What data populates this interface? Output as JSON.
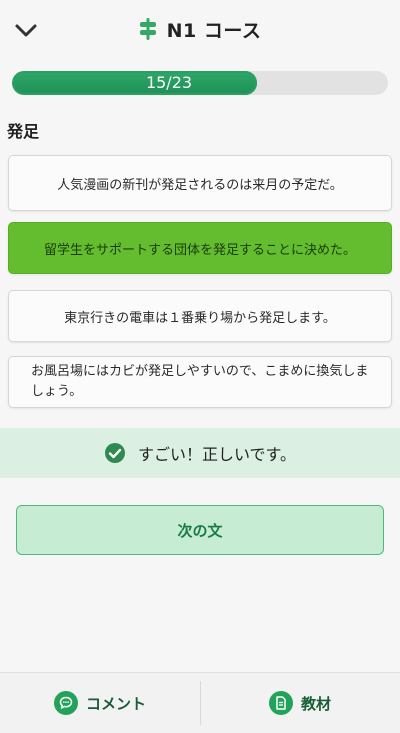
{
  "header": {
    "title": "N1 コース",
    "back_icon": "chevron-down-icon",
    "course_icon": "signpost-icon",
    "accent": "#2fa86a"
  },
  "progress": {
    "label": "15/23",
    "current": 15,
    "total": 23
  },
  "question": {
    "word": "発足"
  },
  "options": [
    {
      "text": "人気漫画の新刊が発足されるのは来月の予定だ。",
      "selected": false
    },
    {
      "text": "留学生をサポートする団体を発足することに決めた。",
      "selected": true
    },
    {
      "text": "東京行きの電車は１番乗り場から発足します。",
      "selected": false
    },
    {
      "text": "お風呂場にはカビが発足しやすいので、こまめに換気しましょう。",
      "selected": false
    }
  ],
  "feedback": {
    "text": "すごい！正しいです。",
    "icon": "check-circle-icon",
    "color": "#dbf0e2"
  },
  "next_button": {
    "label": "次の文"
  },
  "bottom_bar": {
    "comment_label": "コメント",
    "comment_icon": "comment-icon",
    "material_label": "教材",
    "material_icon": "document-icon"
  }
}
